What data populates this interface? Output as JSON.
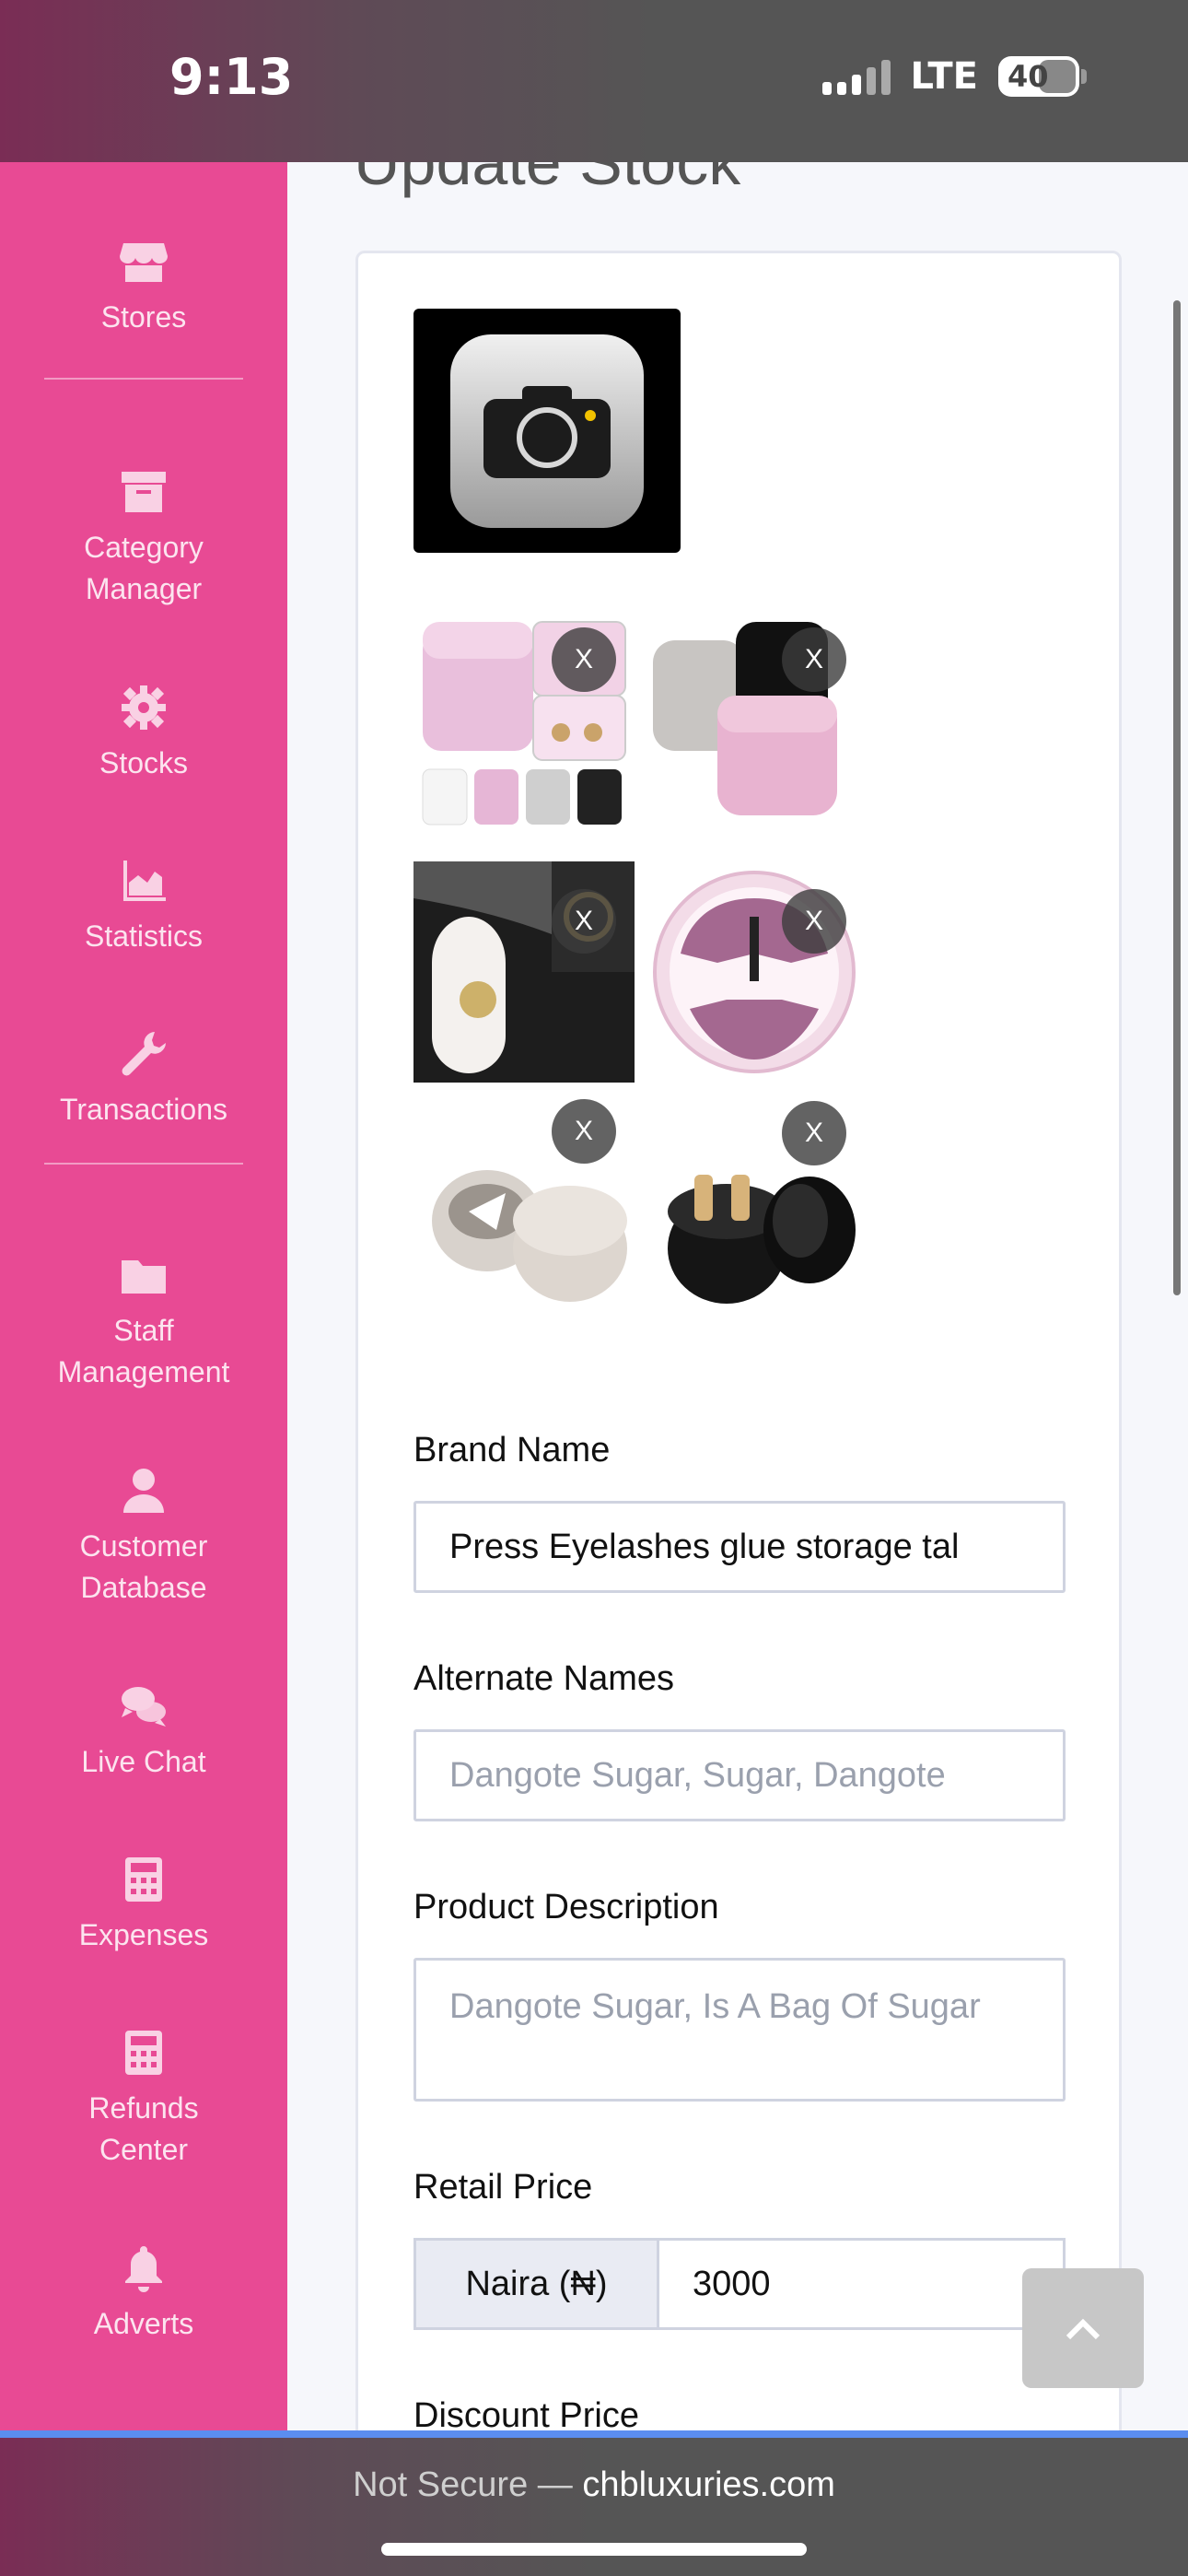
{
  "status": {
    "time": "9:13",
    "network": "LTE",
    "battery": "40"
  },
  "sidebar": {
    "items": [
      {
        "label": "Stores",
        "icon": "store-icon"
      },
      {
        "label": "Category Manager",
        "icon": "archive-icon"
      },
      {
        "label": "Stocks",
        "icon": "gear-icon"
      },
      {
        "label": "Statistics",
        "icon": "area-chart-icon"
      },
      {
        "label": "Transactions",
        "icon": "wrench-icon"
      },
      {
        "label": "Staff Management",
        "icon": "folder-icon"
      },
      {
        "label": "Customer Database",
        "icon": "user-icon"
      },
      {
        "label": "Live Chat",
        "icon": "chat-icon"
      },
      {
        "label": "Expenses",
        "icon": "calculator-icon"
      },
      {
        "label": "Refunds Center",
        "icon": "calculator-icon"
      },
      {
        "label": "Adverts",
        "icon": "bell-icon"
      }
    ]
  },
  "main": {
    "heading_partial": "Update Stock",
    "remove_label": "X",
    "brand_name": {
      "label": "Brand Name",
      "value": "Press Eyelashes glue storage tal"
    },
    "alternate_names": {
      "label": "Alternate Names",
      "placeholder": "Dangote Sugar, Sugar, Dangote"
    },
    "product_description": {
      "label": "Product Description",
      "placeholder": "Dangote Sugar, Is A Bag Of Sugar"
    },
    "retail_price": {
      "label": "Retail Price",
      "currency": "Naira (₦)",
      "value": "3000"
    },
    "discount_price": {
      "label": "Discount Price"
    }
  },
  "browser": {
    "not_secure": "Not Secure —",
    "domain": "chbluxuries.com"
  },
  "colors": {
    "sidebar": "#e84a94",
    "accent_line": "#5b8def"
  }
}
